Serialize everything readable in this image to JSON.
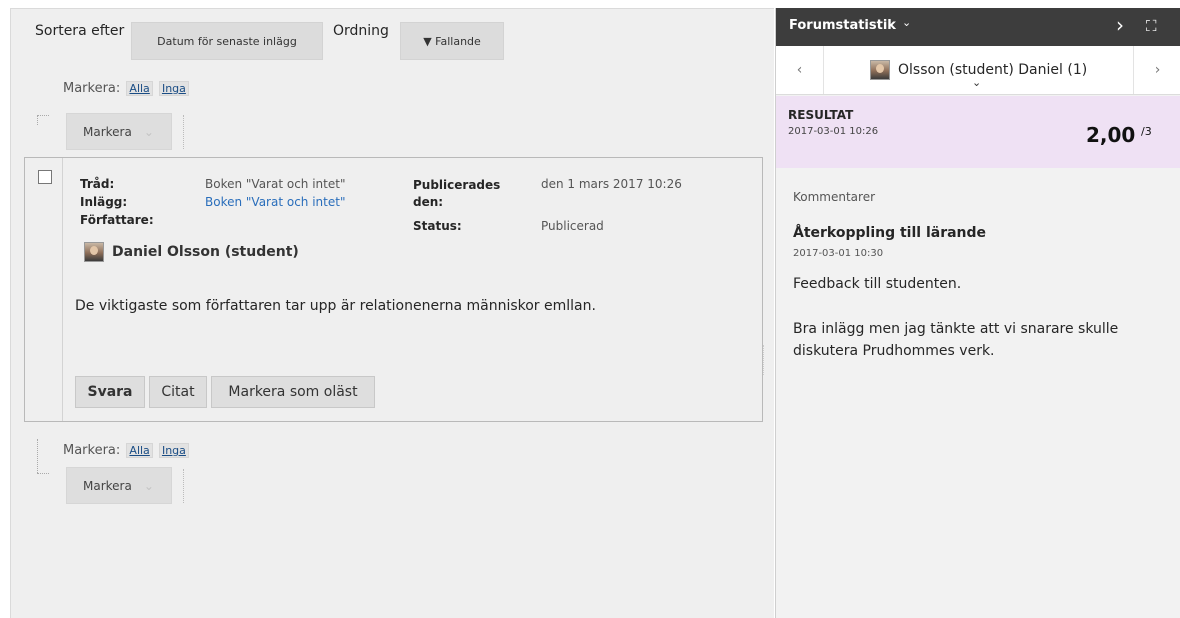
{
  "sort": {
    "label": "Sortera efter",
    "sort_value": "Datum för senaste inlägg",
    "order_label": "Ordning",
    "order_value": "▼ Fallande"
  },
  "select_top": {
    "label": "Markera:",
    "all": "Alla",
    "none": "Inga",
    "button": "Markera"
  },
  "select_bottom": {
    "label": "Markera:",
    "all": "Alla",
    "none": "Inga",
    "button": "Markera"
  },
  "post": {
    "thread_key": "Tråd:",
    "thread_value": "Boken \"Varat och intet\"",
    "post_key": "Inlägg:",
    "post_value": "Boken \"Varat och intet\"",
    "author_key": "Författare:",
    "author_name": "Daniel Olsson (student)",
    "published_key": "Publicerades den:",
    "published_value": "den 1 mars 2017 10:26",
    "status_key": "Status:",
    "status_value": "Publicerad",
    "body": "De viktigaste som författaren tar upp är relationenerna människor emllan.",
    "reply_button": "Svara",
    "quote_button": "Citat",
    "mark_unread_button": "Markera som oläst"
  },
  "sidebar": {
    "title": "Forumstatistik",
    "title_chevron": "⌄",
    "expand_icon": "›",
    "fullscreen_icon": "⛶",
    "nav_prev": "‹",
    "nav_next": "›",
    "student_name": "Olsson (student) Daniel (1)",
    "student_chevron": "⌄",
    "result_label": "RESULTAT",
    "result_date": "2017-03-01 10:26",
    "score": "2,00",
    "score_max": "/3",
    "comments_label": "Kommentarer",
    "feedback_title": "Återkoppling till lärande",
    "feedback_date": "2017-03-01 10:30",
    "feedback_text_1": "Feedback till studenten.",
    "feedback_text_2": "Bra inlägg men jag tänkte att vi snarare skulle diskutera Prudhommes verk."
  },
  "colors": {
    "panel_bg": "#efefef",
    "sidebar_header": "#3d3d3d",
    "result_bg": "#efe1f4",
    "link": "#2a6ebb"
  }
}
